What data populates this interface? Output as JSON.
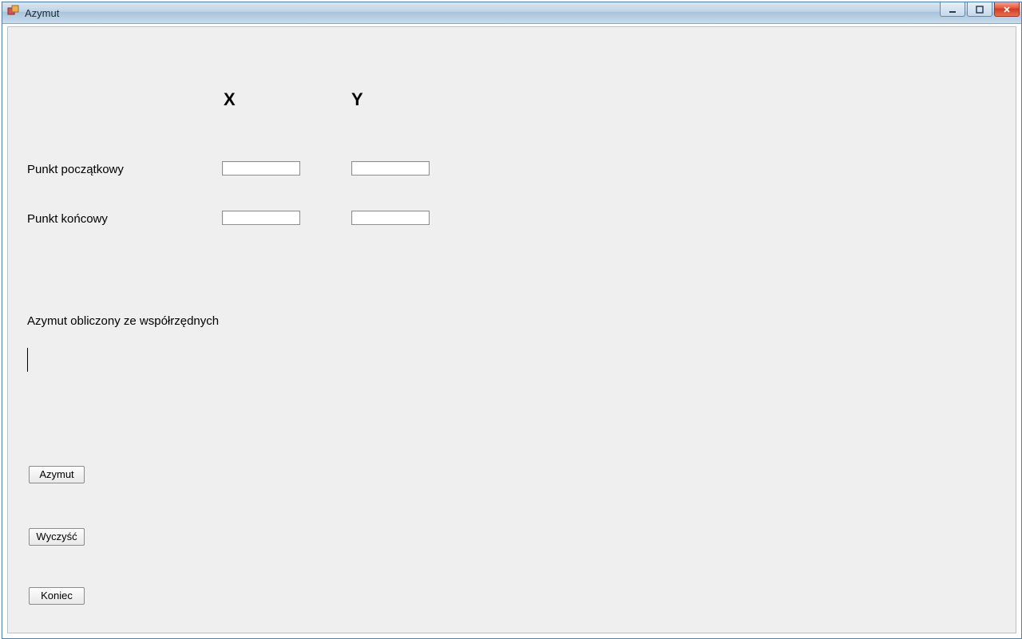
{
  "window": {
    "title": "Azymut"
  },
  "headers": {
    "x": "X",
    "y": "Y"
  },
  "labels": {
    "start_point": "Punkt początkowy",
    "end_point": "Punkt końcowy",
    "result_caption": "Azymut obliczony ze współrzędnych"
  },
  "inputs": {
    "start_x": "",
    "start_y": "",
    "end_x": "",
    "end_y": ""
  },
  "result": {
    "value": ""
  },
  "buttons": {
    "azymut": "Azymut",
    "clear": "Wyczyść",
    "end": "Koniec"
  }
}
